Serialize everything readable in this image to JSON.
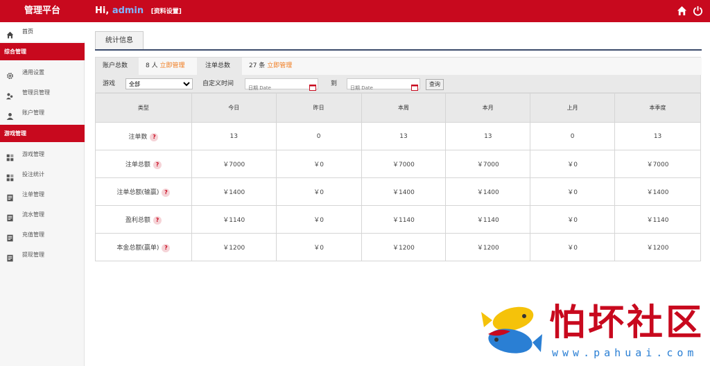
{
  "app": {
    "title": "管理平台"
  },
  "header": {
    "greeting": "Hi,",
    "user": "admin",
    "profile_link": "[资料设置]",
    "icons": [
      "home-icon",
      "power-icon"
    ]
  },
  "sidebar": {
    "home": {
      "label": "首页",
      "icon": "home-icon"
    },
    "groups": [
      {
        "title": "综合管理",
        "items": [
          {
            "label": "通用设置",
            "icon": "gear-icon"
          },
          {
            "label": "管理员管理",
            "icon": "users-icon"
          },
          {
            "label": "账户管理",
            "icon": "user-icon"
          }
        ]
      },
      {
        "title": "游戏管理",
        "items": [
          {
            "label": "游戏管理",
            "icon": "grid-icon"
          },
          {
            "label": "投注统计",
            "icon": "grid-icon"
          },
          {
            "label": "注单管理",
            "icon": "doc-icon"
          },
          {
            "label": "流水管理",
            "icon": "doc-icon"
          },
          {
            "label": "充值管理",
            "icon": "doc-icon"
          },
          {
            "label": "提现管理",
            "icon": "doc-icon"
          }
        ]
      }
    ]
  },
  "main": {
    "tab": "统计信息",
    "summary": {
      "accounts_label": "账户总数",
      "accounts_value": "8 人",
      "accounts_link": "立即管理",
      "bets_label": "注单总数",
      "bets_value": "27 条",
      "bets_link": "立即管理"
    },
    "filter": {
      "game_label": "游戏",
      "game_selected": "全部",
      "custom_time_label": "自定义时间",
      "date_placeholder": "日期 Date",
      "to_label": "到",
      "query_button": "查询"
    },
    "table": {
      "headers": [
        "类型",
        "今日",
        "昨日",
        "本周",
        "本月",
        "上月",
        "本季度"
      ],
      "rows": [
        {
          "label": "注单数",
          "values": [
            "13",
            "0",
            "13",
            "13",
            "0",
            "13"
          ]
        },
        {
          "label": "注单总额",
          "values": [
            "￥7000",
            "￥0",
            "￥7000",
            "￥7000",
            "￥0",
            "￥7000"
          ]
        },
        {
          "label": "注单总额(输赢)",
          "values": [
            "￥1400",
            "￥0",
            "￥1400",
            "￥1400",
            "￥0",
            "￥1400"
          ]
        },
        {
          "label": "盈利总额",
          "values": [
            "￥1140",
            "￥0",
            "￥1140",
            "￥1140",
            "￥0",
            "￥1140"
          ]
        },
        {
          "label": "本金总额(赢单)",
          "values": [
            "￥1200",
            "￥0",
            "￥1200",
            "￥1200",
            "￥0",
            "￥1200"
          ]
        }
      ],
      "help_glyph": "?"
    }
  },
  "watermark": {
    "title": "怕坏社区",
    "url": "www.pahuai.com"
  },
  "colors": {
    "brand": "#c8091e",
    "link": "#f07a1c",
    "username": "#7fb5ff"
  }
}
